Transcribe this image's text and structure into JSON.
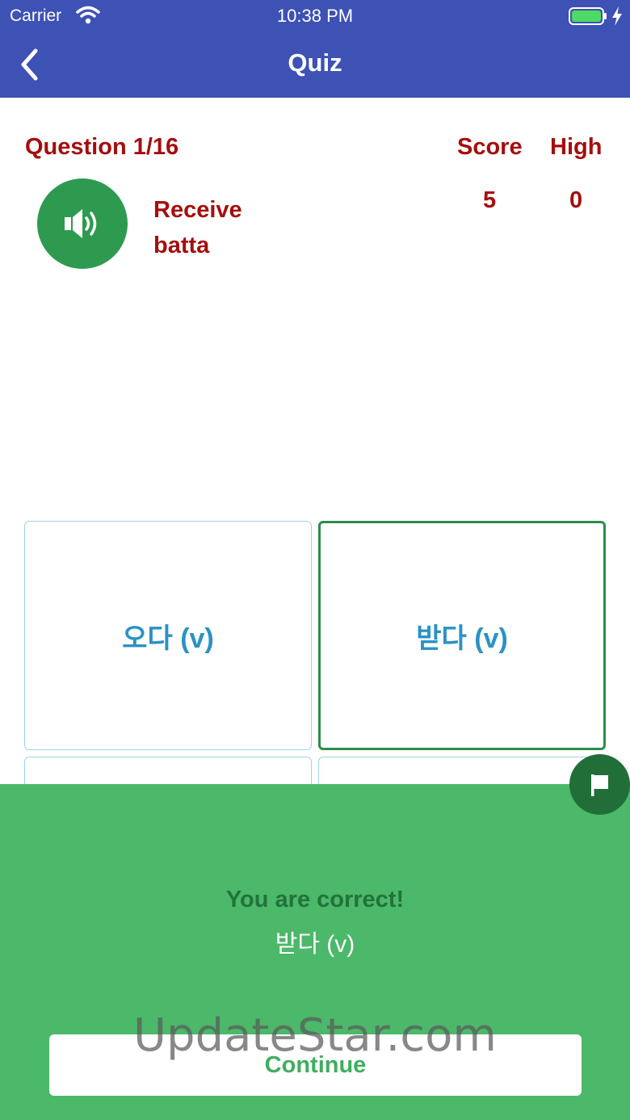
{
  "status_bar": {
    "carrier": "Carrier",
    "time": "10:38 PM"
  },
  "nav": {
    "title": "Quiz"
  },
  "quiz": {
    "question_label": "Question 1/16",
    "score_label": "Score",
    "high_label": "High",
    "score_value": "5",
    "high_value": "0",
    "word_english": "Receive",
    "word_romanized": "batta"
  },
  "options": [
    {
      "label": "오다 (v)"
    },
    {
      "label": "받다 (v)"
    },
    {
      "label": ""
    },
    {
      "label": ""
    }
  ],
  "result": {
    "title": "You are correct!",
    "answer": "받다 (v)",
    "continue_label": "Continue"
  },
  "watermark": "UpdateStar.com",
  "colors": {
    "nav": "#3e51b5",
    "text_red": "#a50e0e",
    "speaker_green": "#2e9a50",
    "tile_text": "#2a92c4",
    "panel_green": "#4bb86a",
    "flag_green": "#216e39"
  },
  "icons": {
    "back": "chevron-left-icon",
    "speaker": "speaker-icon",
    "flag": "flag-icon",
    "wifi": "wifi-icon",
    "battery": "battery-icon"
  }
}
